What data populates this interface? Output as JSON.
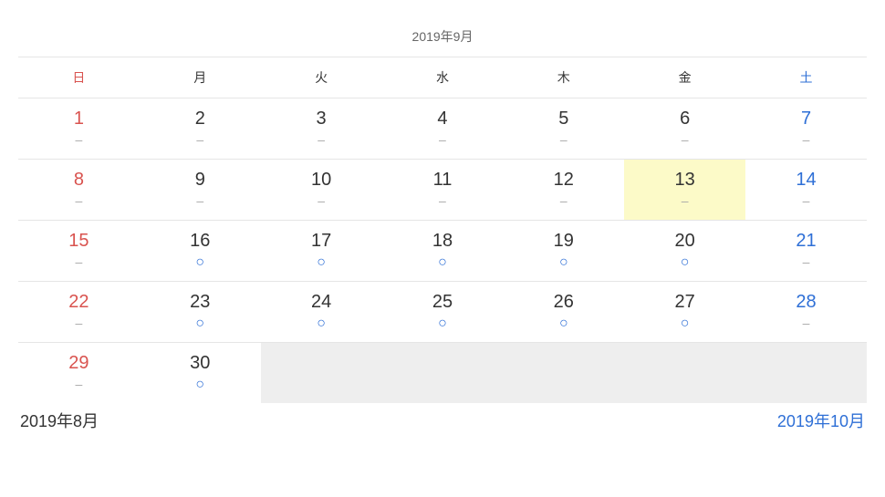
{
  "title": "2019年9月",
  "weekdays": [
    "日",
    "月",
    "火",
    "水",
    "木",
    "金",
    "土"
  ],
  "days": [
    {
      "num": "1",
      "status": "–",
      "dow": 0
    },
    {
      "num": "2",
      "status": "–",
      "dow": 1
    },
    {
      "num": "3",
      "status": "–",
      "dow": 2
    },
    {
      "num": "4",
      "status": "–",
      "dow": 3
    },
    {
      "num": "5",
      "status": "–",
      "dow": 4
    },
    {
      "num": "6",
      "status": "–",
      "dow": 5
    },
    {
      "num": "7",
      "status": "–",
      "dow": 6
    },
    {
      "num": "8",
      "status": "–",
      "dow": 0
    },
    {
      "num": "9",
      "status": "–",
      "dow": 1
    },
    {
      "num": "10",
      "status": "–",
      "dow": 2
    },
    {
      "num": "11",
      "status": "–",
      "dow": 3
    },
    {
      "num": "12",
      "status": "–",
      "dow": 4
    },
    {
      "num": "13",
      "status": "–",
      "dow": 5,
      "highlight": true
    },
    {
      "num": "14",
      "status": "–",
      "dow": 6
    },
    {
      "num": "15",
      "status": "–",
      "dow": 0
    },
    {
      "num": "16",
      "status": "○",
      "dow": 1
    },
    {
      "num": "17",
      "status": "○",
      "dow": 2
    },
    {
      "num": "18",
      "status": "○",
      "dow": 3
    },
    {
      "num": "19",
      "status": "○",
      "dow": 4
    },
    {
      "num": "20",
      "status": "○",
      "dow": 5
    },
    {
      "num": "21",
      "status": "–",
      "dow": 6
    },
    {
      "num": "22",
      "status": "–",
      "dow": 0
    },
    {
      "num": "23",
      "status": "○",
      "dow": 1
    },
    {
      "num": "24",
      "status": "○",
      "dow": 2
    },
    {
      "num": "25",
      "status": "○",
      "dow": 3
    },
    {
      "num": "26",
      "status": "○",
      "dow": 4
    },
    {
      "num": "27",
      "status": "○",
      "dow": 5
    },
    {
      "num": "28",
      "status": "–",
      "dow": 6
    },
    {
      "num": "29",
      "status": "–",
      "dow": 0
    },
    {
      "num": "30",
      "status": "○",
      "dow": 1
    },
    {
      "blank": true
    },
    {
      "blank": true
    },
    {
      "blank": true
    },
    {
      "blank": true
    },
    {
      "blank": true
    }
  ],
  "nav": {
    "prev": "2019年8月",
    "next": "2019年10月"
  }
}
